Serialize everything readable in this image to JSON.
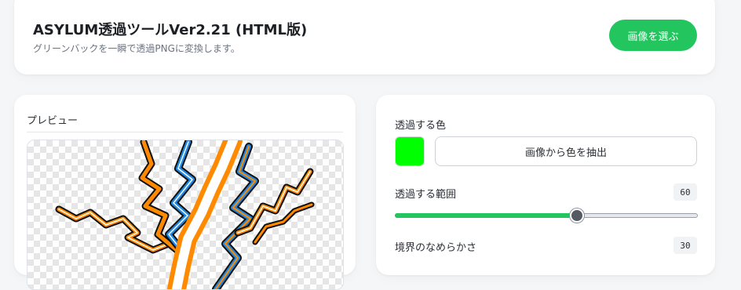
{
  "header": {
    "title": "ASYLUM透過ツールVer2.21 (HTML版)",
    "subtitle": "グリーンバックを一瞬で透過PNGに変換します。",
    "choose_image_label": "画像を選ぶ"
  },
  "preview": {
    "label": "プレビュー"
  },
  "settings": {
    "transparent_color_label": "透過する色",
    "transparent_color": "#00ff00",
    "extract_color_label": "画像から色を抽出",
    "range_label": "透過する範囲",
    "range_value": "60",
    "range_fraction": 0.6,
    "smoothness_label": "境界のなめらかさ",
    "smoothness_value": "30"
  },
  "colors": {
    "accent": "#22c55e",
    "lightning_orange": "#ff8a00",
    "lightning_blue": "#1e88e5"
  }
}
